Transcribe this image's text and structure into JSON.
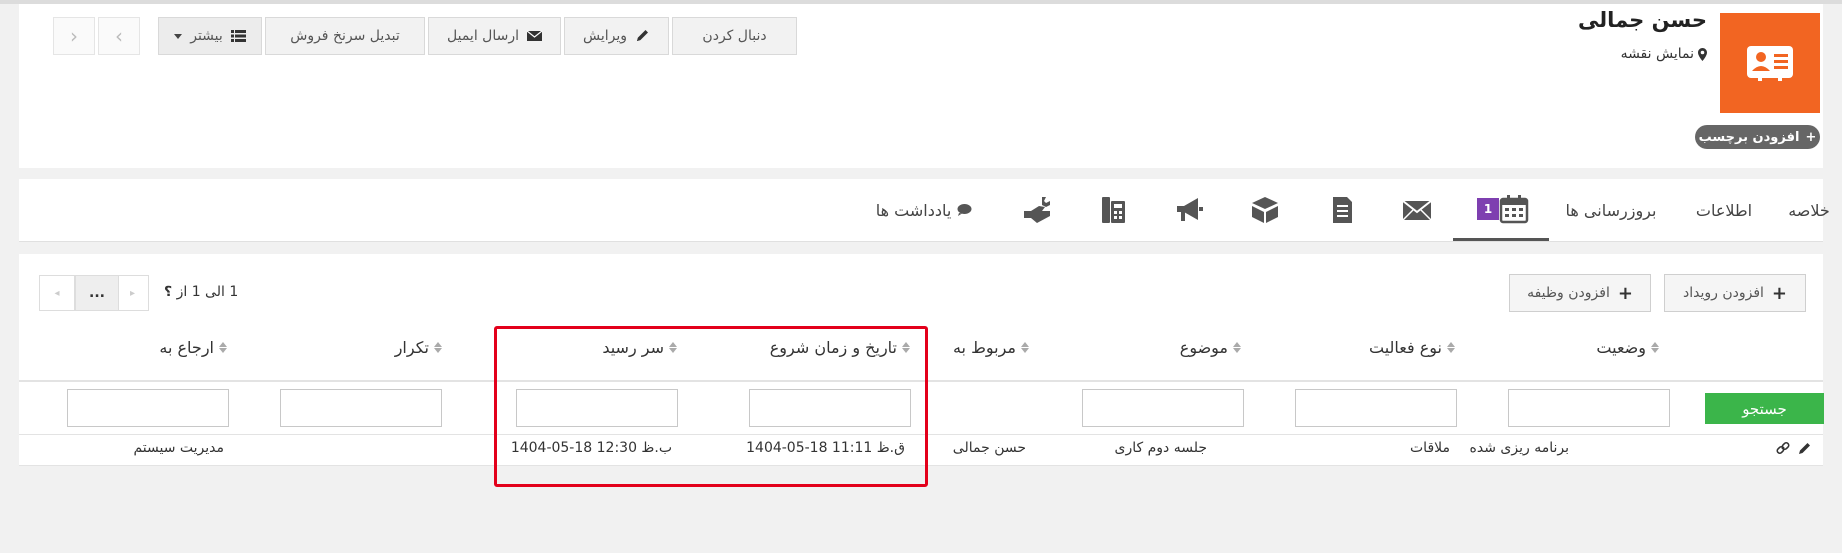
{
  "header": {
    "contact_name": "حسن جمالی",
    "map_link": "نمایش نقشه",
    "add_tag": "افزودن برچسب",
    "buttons": {
      "follow": "دنبال کردن",
      "edit": "ویرایش",
      "send_email": "ارسال ایمیل",
      "convert": "تبدیل سرنخ فروش",
      "more": "بیشتر"
    },
    "colors": {
      "avatar": "#f26522",
      "tag_pill": "#666666"
    }
  },
  "tabs": {
    "summary": "خلاصه",
    "info": "اطلاعات",
    "updates": "بروزرسانی ها",
    "calendar_badge": "1",
    "notes": "یادداشت ها",
    "icons": [
      "calendar-icon",
      "envelope-icon",
      "document-icon",
      "box-icon",
      "megaphone-icon",
      "phone-icon",
      "tools-icon",
      "comment-icon"
    ],
    "badge_color": "#7e3fb0"
  },
  "toolbar": {
    "add_event": "افزودن رویداد",
    "add_task": "افزودن وظیفه",
    "pager_info": "1 الی 1  از",
    "pager_total": "؟",
    "pager_dots": "..."
  },
  "table": {
    "columns": {
      "status": "وضعیت",
      "activity_type": "نوع فعالیت",
      "subject": "موضوع",
      "related_to": "مربوط به",
      "start_datetime": "تاریخ و زمان شروع",
      "due": "سر رسید",
      "repeat": "تکرار",
      "assigned_to": "ارجاع به"
    },
    "search_button": "جستجو",
    "search_color": "#3bb54a",
    "rows": [
      {
        "status": "برنامه ریزی شده",
        "activity_type": "ملاقات",
        "subject": "جلسه دوم کاری",
        "related_to": "حسن جمالی",
        "start_datetime": "1404-05-18 11:11 ق.ظ",
        "due": "1404-05-18 12:30 ب.ظ",
        "repeat": "",
        "assigned_to": "مدیریت سیستم"
      }
    ]
  },
  "highlight_color": "#e3001b"
}
